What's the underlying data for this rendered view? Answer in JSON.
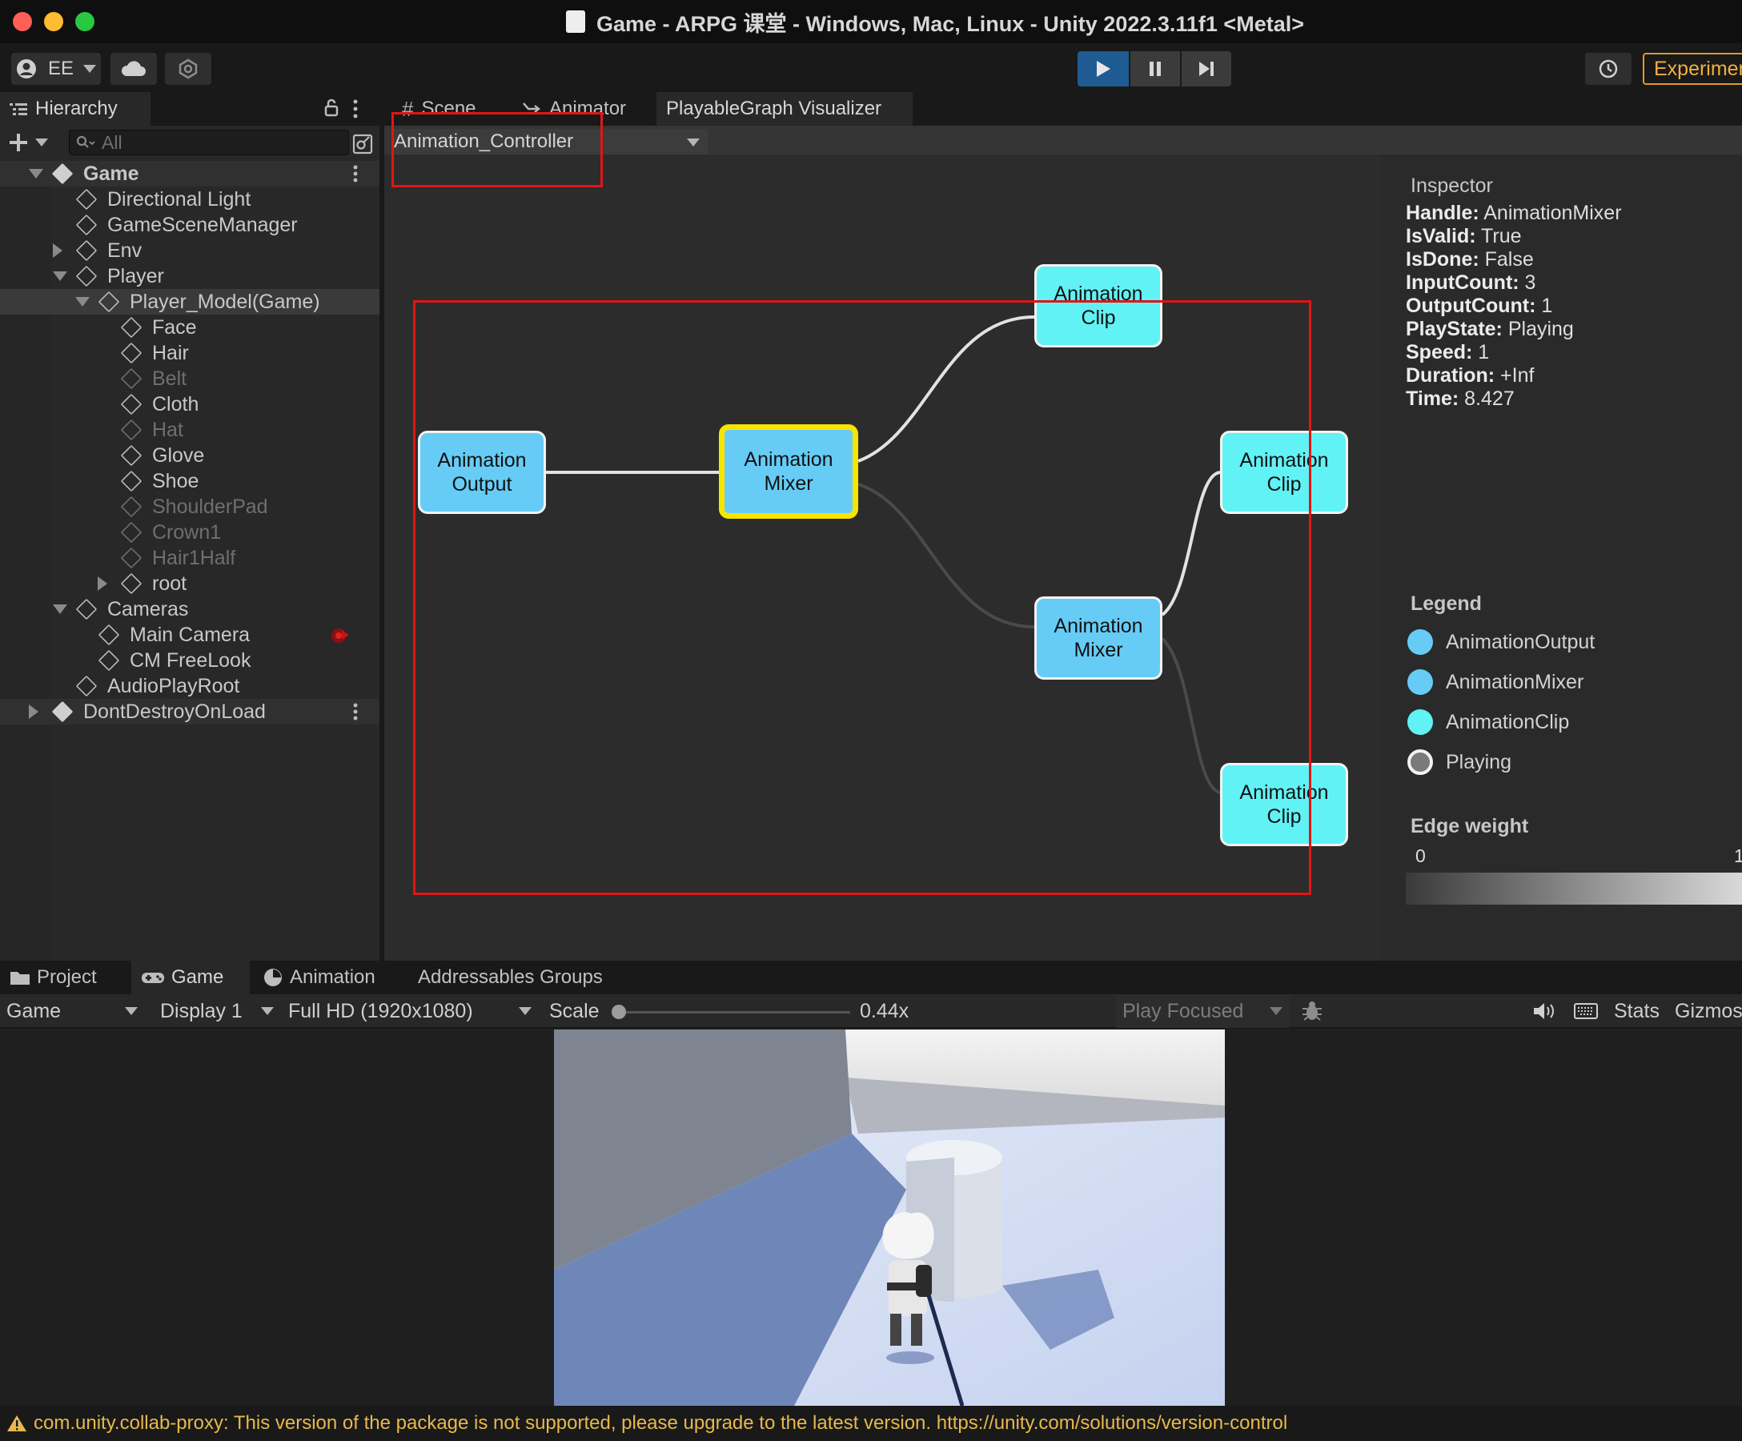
{
  "window": {
    "title": "Game - ARPG 课堂 - Windows, Mac, Linux - Unity 2022.3.11f1 <Metal>"
  },
  "toolbar": {
    "account_label": "EE",
    "experimental_label": "Experimen"
  },
  "hierarchy": {
    "tab_label": "Hierarchy",
    "search_placeholder": "All",
    "rows": [
      {
        "label": "Game",
        "depth": 0,
        "expander": "down",
        "root": true,
        "dim": false
      },
      {
        "label": "Directional Light",
        "depth": 1,
        "expander": "",
        "root": false,
        "dim": false
      },
      {
        "label": "GameSceneManager",
        "depth": 1,
        "expander": "",
        "root": false,
        "dim": false
      },
      {
        "label": "Env",
        "depth": 1,
        "expander": "right",
        "root": false,
        "dim": false
      },
      {
        "label": "Player",
        "depth": 1,
        "expander": "down",
        "root": false,
        "dim": false
      },
      {
        "label": "Player_Model(Game)",
        "depth": 2,
        "expander": "down",
        "root": false,
        "dim": false,
        "selected": true
      },
      {
        "label": "Face",
        "depth": 3,
        "expander": "",
        "root": false,
        "dim": false
      },
      {
        "label": "Hair",
        "depth": 3,
        "expander": "",
        "root": false,
        "dim": false
      },
      {
        "label": "Belt",
        "depth": 3,
        "expander": "",
        "root": false,
        "dim": true
      },
      {
        "label": "Cloth",
        "depth": 3,
        "expander": "",
        "root": false,
        "dim": false
      },
      {
        "label": "Hat",
        "depth": 3,
        "expander": "",
        "root": false,
        "dim": true
      },
      {
        "label": "Glove",
        "depth": 3,
        "expander": "",
        "root": false,
        "dim": false
      },
      {
        "label": "Shoe",
        "depth": 3,
        "expander": "",
        "root": false,
        "dim": false
      },
      {
        "label": "ShoulderPad",
        "depth": 3,
        "expander": "",
        "root": false,
        "dim": true
      },
      {
        "label": "Crown1",
        "depth": 3,
        "expander": "",
        "root": false,
        "dim": true
      },
      {
        "label": "Hair1Half",
        "depth": 3,
        "expander": "",
        "root": false,
        "dim": true
      },
      {
        "label": "root",
        "depth": 3,
        "expander": "right",
        "root": false,
        "dim": false
      },
      {
        "label": "Cameras",
        "depth": 1,
        "expander": "down",
        "root": false,
        "dim": false
      },
      {
        "label": "Main Camera",
        "depth": 2,
        "expander": "",
        "root": false,
        "dim": false
      },
      {
        "label": "CM FreeLook",
        "depth": 2,
        "expander": "",
        "root": false,
        "dim": false
      },
      {
        "label": "AudioPlayRoot",
        "depth": 1,
        "expander": "",
        "root": false,
        "dim": false
      },
      {
        "label": "DontDestroyOnLoad",
        "depth": 0,
        "expander": "right",
        "root": true,
        "dim": false
      }
    ]
  },
  "center_tabs": [
    {
      "label": "Scene",
      "icon": "hash-icon"
    },
    {
      "label": "Animator",
      "icon": "animator-icon"
    },
    {
      "label": "PlayableGraph Visualizer",
      "icon": ""
    }
  ],
  "visualizer": {
    "graph_dropdown": "Animation_Controller",
    "nodes": [
      {
        "id": "output",
        "text": "Animation\nOutput",
        "kind": "AnimationOutput"
      },
      {
        "id": "mixer1",
        "text": "Animation\nMixer",
        "kind": "AnimationMixer",
        "selected": true
      },
      {
        "id": "clip1",
        "text": "Animation\nClip",
        "kind": "AnimationClip"
      },
      {
        "id": "mixer2",
        "text": "Animation\nMixer",
        "kind": "AnimationMixer"
      },
      {
        "id": "clip2",
        "text": "Animation\nClip",
        "kind": "AnimationClip"
      },
      {
        "id": "clip3",
        "text": "Animation\nClip",
        "kind": "AnimationClip"
      }
    ],
    "edges": [
      {
        "from": "output",
        "to": "mixer1",
        "weight": 1
      },
      {
        "from": "mixer1",
        "to": "clip1",
        "weight": 1
      },
      {
        "from": "mixer1",
        "to": "mixer2",
        "weight": 0.2
      },
      {
        "from": "mixer2",
        "to": "clip2",
        "weight": 1
      },
      {
        "from": "mixer2",
        "to": "clip3",
        "weight": 0.2
      }
    ]
  },
  "inspector": {
    "heading": "Inspector",
    "fields": [
      {
        "key": "Handle:",
        "value": " AnimationMixer"
      },
      {
        "key": "IsValid:",
        "value": " True"
      },
      {
        "key": "IsDone:",
        "value": " False"
      },
      {
        "key": "InputCount:",
        "value": " 3"
      },
      {
        "key": "OutputCount:",
        "value": " 1"
      },
      {
        "key": "PlayState:",
        "value": " Playing"
      },
      {
        "key": "Speed:",
        "value": " 1"
      },
      {
        "key": "Duration:",
        "value": " +Inf"
      },
      {
        "key": "Time:",
        "value": " 8.427"
      }
    ]
  },
  "legend": {
    "heading": "Legend",
    "items": [
      {
        "label": "AnimationOutput",
        "color": "#66ccf6"
      },
      {
        "label": "AnimationMixer",
        "color": "#66ccf6"
      },
      {
        "label": "AnimationClip",
        "color": "#61f2f5"
      },
      {
        "label": "Playing",
        "color": "#7a7a7a"
      }
    ],
    "edge_weight_heading": "Edge weight",
    "edge_weight_min": "0",
    "edge_weight_max": "1"
  },
  "bottom_tabs": [
    {
      "label": "Project",
      "icon": "folder-icon"
    },
    {
      "label": "Game",
      "icon": "gamepad-icon"
    },
    {
      "label": "Animation",
      "icon": "clock-icon"
    },
    {
      "label": "Addressables Groups",
      "icon": ""
    }
  ],
  "game_toolbar": {
    "view_select": "Game",
    "display_select": "Display 1",
    "resolution_select": "Full HD (1920x1080)",
    "scale_label": "Scale",
    "scale_value": "0.44x",
    "scale_fraction": 0.0,
    "play_mode_select": "Play Focused",
    "stats_label": "Stats",
    "gizmos_label": "Gizmos"
  },
  "status_bar": {
    "message": "com.unity.collab-proxy: This version of the package is not supported, please upgrade to the latest version. https://unity.com/solutions/version-control",
    "color": "#e6b94c"
  }
}
